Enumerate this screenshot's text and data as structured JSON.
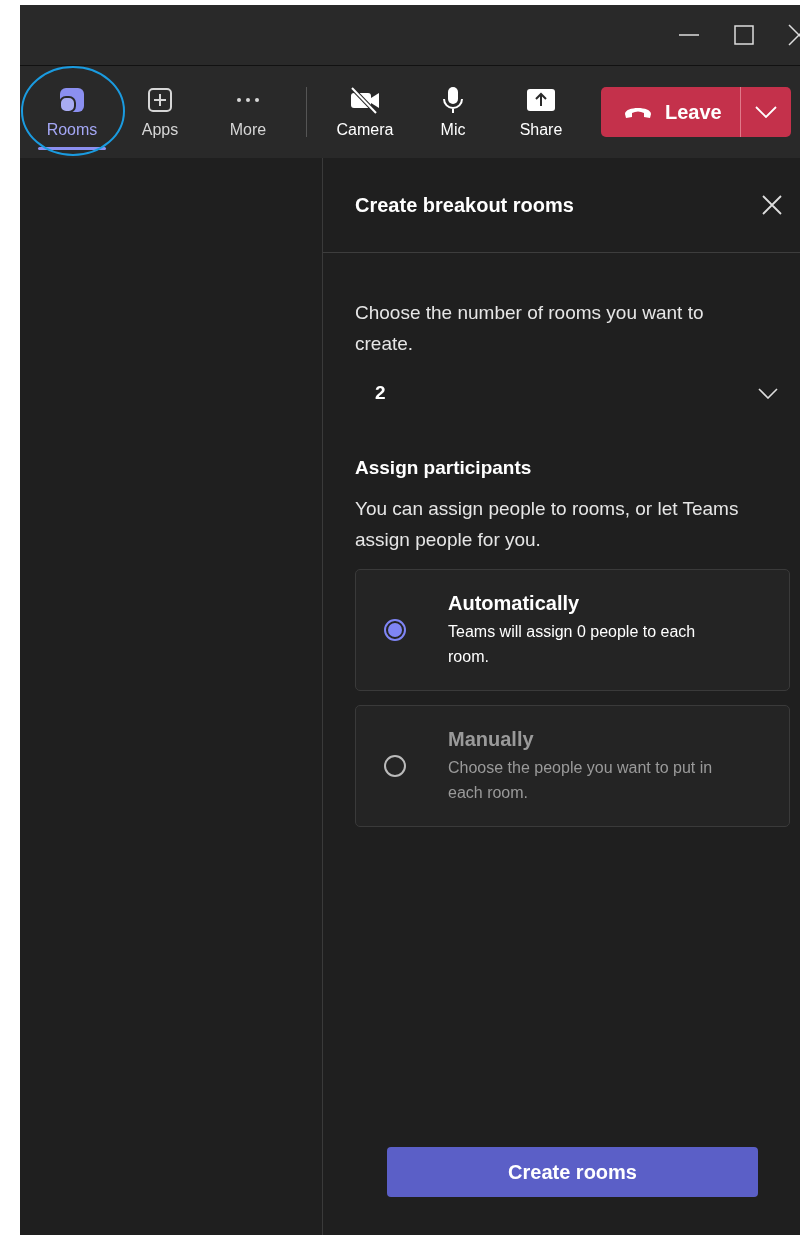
{
  "toolbar": {
    "items": [
      {
        "label": "Rooms",
        "selected": true
      },
      {
        "label": "Apps",
        "selected": false
      },
      {
        "label": "More",
        "selected": false
      },
      {
        "label": "Camera",
        "selected": false
      },
      {
        "label": "Mic",
        "selected": false
      },
      {
        "label": "Share",
        "selected": false
      }
    ],
    "leave_button": {
      "label": "Leave"
    }
  },
  "panel": {
    "title": "Create breakout rooms",
    "rooms_prompt": "Choose the number of rooms you want to create.",
    "rooms_count": "2",
    "assign_heading": "Assign participants",
    "assign_text": "You can assign people to rooms, or let Teams assign people for you.",
    "options": [
      {
        "title": "Automatically",
        "description": "Teams will assign 0 people to each room.",
        "selected": true
      },
      {
        "title": "Manually",
        "description": "Choose the people you want to put in each room.",
        "selected": false
      }
    ],
    "create_button": "Create rooms"
  }
}
